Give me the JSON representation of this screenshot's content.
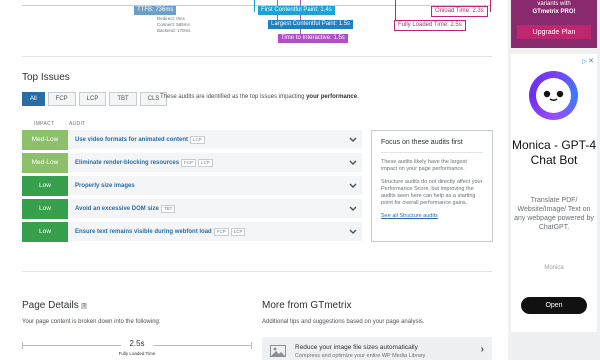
{
  "waterfall": {
    "ttfb": {
      "label": "TTFB: 736ms",
      "redirect": "Redirect: 0ms",
      "connect": "Connect: 565ms",
      "backend": "Backend: 170ms"
    },
    "fcp": "First Contentful Paint: 1.4s",
    "lcp": "Largest Contentful Paint: 1.5s",
    "tti": "Time to Interactive: 1.5s",
    "onload": "Onload Time: 2.3s",
    "fully_loaded": "Fully Loaded Time: 2.5s"
  },
  "top_issues": {
    "title": "Top Issues",
    "tabs": [
      "All",
      "FCP",
      "LCP",
      "TBT",
      "CLS"
    ],
    "note_prefix": "These audits are identified as the top issues impacting ",
    "note_bold": "your performance",
    "note_suffix": ".",
    "col_impact": "IMPACT",
    "col_audit": "AUDIT",
    "rows": [
      {
        "impact": "Med-Low",
        "audit": "Use video formats for animated content",
        "tags": [
          "LCP"
        ]
      },
      {
        "impact": "Med-Low",
        "audit": "Eliminate render-blocking resources",
        "tags": [
          "FCP",
          "LCP"
        ]
      },
      {
        "impact": "Low",
        "audit": "Properly size images",
        "tags": []
      },
      {
        "impact": "Low",
        "audit": "Avoid an excessive DOM size",
        "tags": [
          "TBT"
        ]
      },
      {
        "impact": "Low",
        "audit": "Ensure text remains visible during webfont load",
        "tags": [
          "FCP",
          "LCP"
        ]
      }
    ]
  },
  "focus": {
    "title": "Focus on these audits first",
    "p1": "These audits likely have the largest impact on your page performance.",
    "p2": "Structure audits do not directly affect your Performance Score, but improving the audits seen here can help as a starting point for overall performance gains.",
    "link": "See all Structure audits"
  },
  "page_details": {
    "title": "Page Details",
    "help": "?",
    "sub": "Your page content is broken down into the following:",
    "value": "2.5s",
    "label": "Fully Loaded Time"
  },
  "more": {
    "title": "More from GTmetrix",
    "sub": "Additional tips and suggestions based on your page analysis.",
    "tip_title": "Reduce your image file sizes automatically",
    "tip_sub": "Compress and optimize your entire WP Media Library"
  },
  "promo": {
    "text1": "variants with",
    "text2": "GTmetrix PRO!",
    "button": "Upgrade Plan"
  },
  "ad": {
    "adchoices": "▷",
    "close": "✕",
    "headline": "Monica - GPT-4 Chat Bot",
    "desc": "Translate PDF/ Website/Image/ Text on any webpage powered by ChatGPT.",
    "brand": "Monica",
    "cta": "Open"
  },
  "colors": {
    "blue": "#2a6da4",
    "pink": "#c0266d",
    "purple": "#b04fc8",
    "cyan": "#1aa3d8",
    "med_low": "#8cc06a",
    "low": "#37a04d"
  }
}
